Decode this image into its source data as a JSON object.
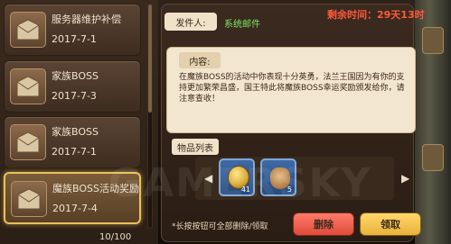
{
  "mail_list": [
    {
      "title": "服务器维护补偿",
      "date": "2017-7-1",
      "selected": false
    },
    {
      "title": "家族BOSS",
      "date": "2017-7-3",
      "selected": false
    },
    {
      "title": "家族BOSS",
      "date": "2017-7-1",
      "selected": false
    },
    {
      "title": "魔族BOSS活动奖励",
      "date": "2017-7-4",
      "selected": true
    }
  ],
  "mail_count": "10/100",
  "detail": {
    "sender_label": "发件人:",
    "sender": "系统邮件",
    "remaining": "剩余时间：29天13时",
    "content_label": "内容:",
    "content": "在魔族BOSS的活动中你表现十分英勇，法兰王国因为有你的支持更加繁荣昌盛，国王特此将魔族BOSS幸运奖励颁发给你，请注意查收！",
    "items_label": "物品列表",
    "items": [
      {
        "icon": "gold-coin-icon",
        "qty": "41"
      },
      {
        "icon": "coin-bag-icon",
        "qty": "5"
      }
    ],
    "hint": "*长按按钮可全部删除/领取",
    "delete_label": "删除",
    "claim_label": "领取"
  },
  "watermark": "GAMERSKY"
}
